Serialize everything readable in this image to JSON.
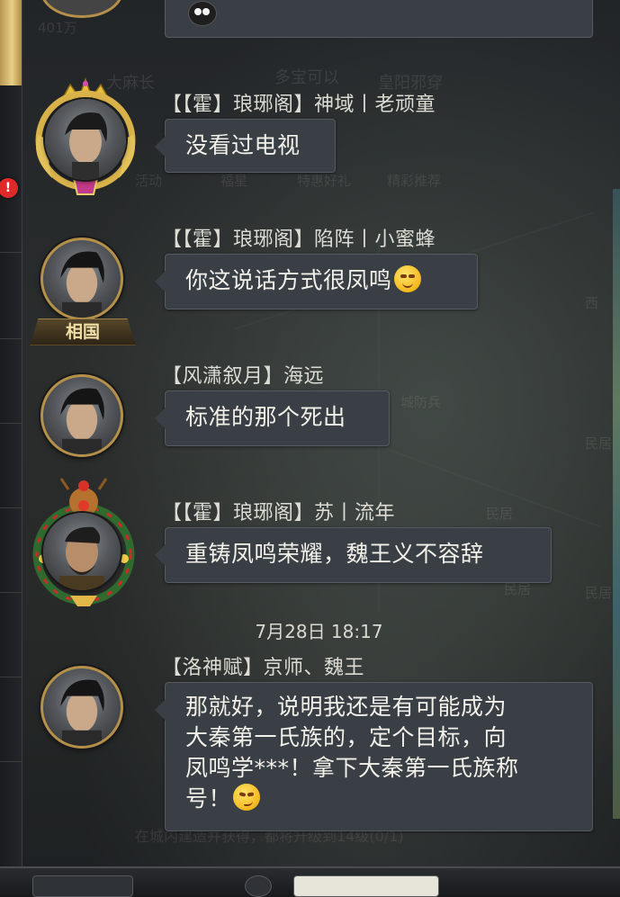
{
  "faded_background": {
    "top_left_number": "401万",
    "map_labels": [
      "大麻长",
      "多宝可以",
      "皇阳邪穿"
    ],
    "menu_labels": [
      "活动",
      "福星",
      "特惠好礼",
      "精彩推荐"
    ],
    "places": [
      "西",
      "城防兵",
      "民居",
      "民居",
      "民居",
      "民居"
    ],
    "bottom_hint": "在城内建造并获得，都将升级到14级(0/1)"
  },
  "alert_badge": "!",
  "messages": [
    {
      "name": "【【霍】琅琊阁】神域丨老顽童",
      "text": "没看过电视",
      "avatar": "gold-crown-frame",
      "badge": ""
    },
    {
      "name": "【【霍】琅琊阁】陷阵丨小蜜蜂",
      "text": "你这说话方式很凤鸣",
      "emoji": "blush-emoji-icon",
      "badge": "相国"
    },
    {
      "name": "【风潇叙月】海远",
      "text": "标准的那个死出",
      "badge": ""
    },
    {
      "name": "【【霍】琅琊阁】苏丨流年",
      "text": "重铸凤鸣荣耀，魏王义不容辞",
      "avatar": "christmas-frame",
      "badge": ""
    }
  ],
  "timestamp": "7月28日 18:17",
  "last_message": {
    "name": "【洛神赋】京师、魏王",
    "lines": [
      "那就好，说明我还是有可能成为",
      "大秦第一氏族的，定个目标，向",
      "凤鸣学***！拿下大秦第一氏族称",
      "号！"
    ],
    "emoji": "smirk-emoji-icon"
  }
}
